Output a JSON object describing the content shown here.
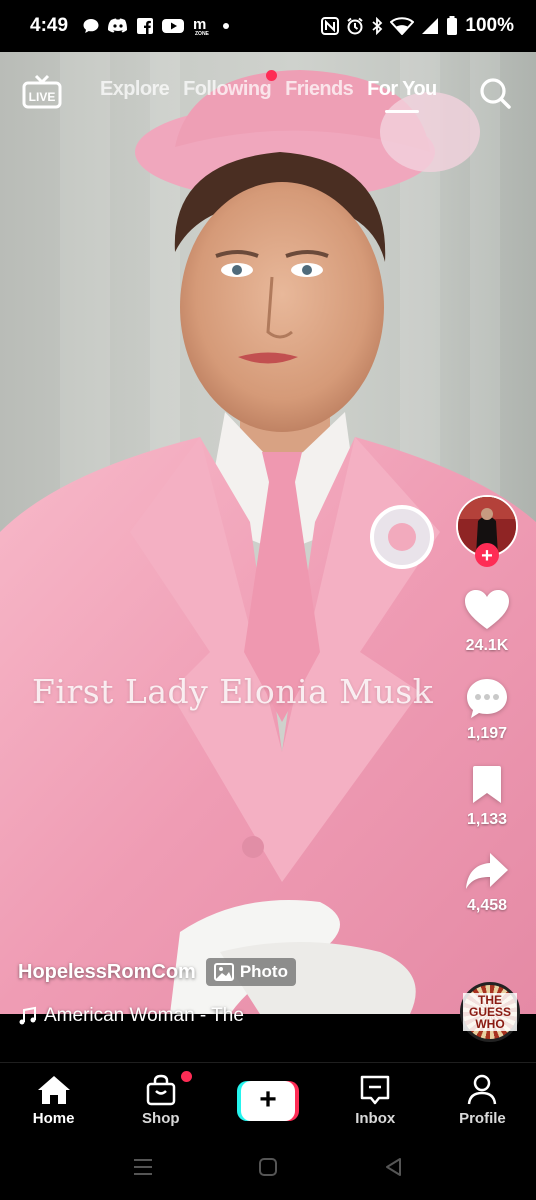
{
  "status_bar": {
    "time": "4:49",
    "battery": "100%",
    "left_icons": [
      "chat-bubble-icon",
      "discord-icon",
      "facebook-icon",
      "youtube-icon",
      "m-zone-icon",
      "dot-icon"
    ],
    "right_icons": [
      "nfc-icon",
      "alarm-icon",
      "bluetooth-icon",
      "wifi-icon",
      "signal-icon",
      "battery-icon"
    ]
  },
  "top_nav": {
    "live_label": "LIVE",
    "tabs": [
      "Explore",
      "Following",
      "Friends",
      "For You"
    ],
    "active_tab": "For You"
  },
  "video": {
    "caption": "First Lady Elonia Musk"
  },
  "actions": {
    "likes": "24.1K",
    "comments": "1,197",
    "saves": "1,133",
    "shares": "4,458"
  },
  "post": {
    "username": "HopelessRomCom",
    "badge": "Photo",
    "music": "American Woman - The",
    "disc_label": "THE GUESS WHO"
  },
  "bottom_nav": {
    "items": [
      {
        "label": "Home",
        "icon": "home-icon"
      },
      {
        "label": "Shop",
        "icon": "shop-bag-icon"
      },
      {
        "label": "",
        "icon": "plus-icon"
      },
      {
        "label": "Inbox",
        "icon": "inbox-icon"
      },
      {
        "label": "Profile",
        "icon": "profile-icon"
      }
    ],
    "active": "Home"
  },
  "colors": {
    "accent_red": "#fe2c55",
    "accent_cyan": "#25f4ee",
    "suit_pink": "#f2a3b8"
  }
}
